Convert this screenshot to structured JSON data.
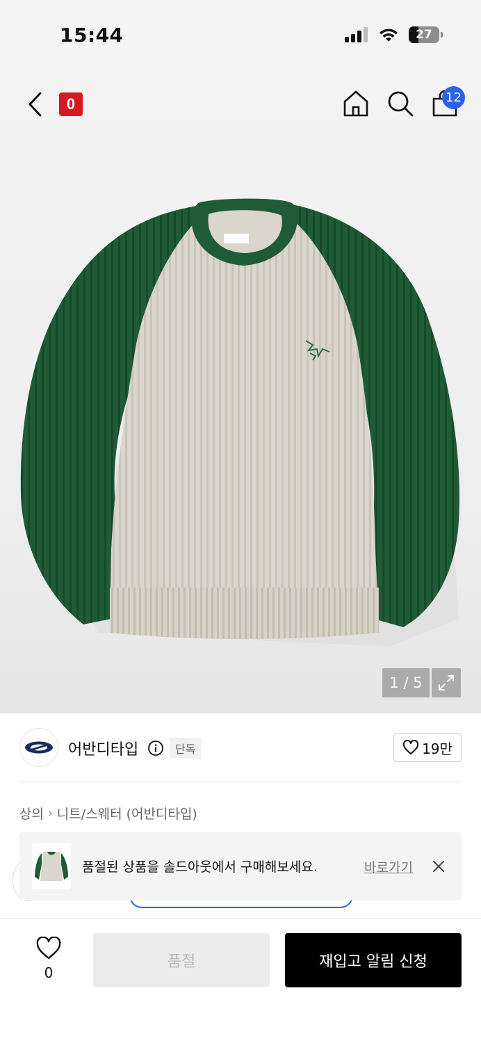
{
  "status_bar": {
    "time": "15:44",
    "battery": "27"
  },
  "header": {
    "logo_text": "0",
    "cart_count": "12"
  },
  "gallery": {
    "pager": "1 / 5"
  },
  "brand": {
    "name": "어반디타입",
    "tag": "단독",
    "likes": "19만"
  },
  "breadcrumb": {
    "category": "상의",
    "subcategory": "니트/스웨터 (어반디타입)"
  },
  "toast": {
    "message": "품절된 상품을 솔드아웃에서 구매해보세요.",
    "link": "바로가기"
  },
  "bottom": {
    "wish_count": "0",
    "soldout_label": "품절",
    "restock_label": "재입고 알림 신청"
  },
  "colors": {
    "accent_blue": "#2b63e6",
    "brand_red": "#d71920",
    "sweater_green": "#1d5a33",
    "sweater_cream": "#dcd8ce"
  }
}
